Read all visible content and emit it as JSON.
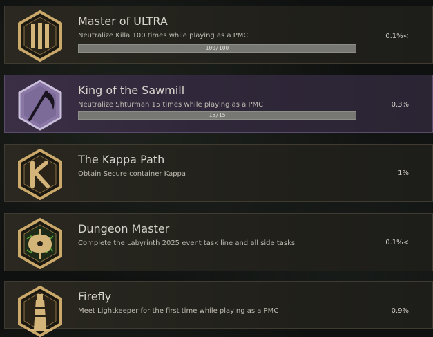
{
  "achievements": [
    {
      "title": "Master of ULTRA",
      "description": "Neutralize Killa 100 times while playing as a PMC",
      "progress_text": "100/100",
      "progress_fraction": 1.0,
      "rarity": "0.1%<",
      "icon": "triple-bars-icon",
      "theme": "gold"
    },
    {
      "title": "King of the Sawmill",
      "description": "Neutralize Shturman 15 times while playing as a PMC",
      "progress_text": "15/15",
      "progress_fraction": 1.0,
      "rarity": "0.3%",
      "icon": "scythe-icon",
      "theme": "purple"
    },
    {
      "title": "The Kappa Path",
      "description": "Obtain Secure container Kappa",
      "rarity": "1%",
      "icon": "kappa-icon",
      "theme": "gold"
    },
    {
      "title": "Dungeon Master",
      "description": "Complete the Labyrinth 2025 event task line and all side tasks",
      "rarity": "0.1%<",
      "icon": "battle-axe-icon",
      "theme": "gold"
    },
    {
      "title": "Firefly",
      "description": "Meet Lightkeeper for the first time while playing as a PMC",
      "rarity": "0.9%",
      "icon": "lighthouse-icon",
      "theme": "gold"
    }
  ],
  "colors": {
    "gold": "#c9a86a",
    "purple_badge": "#8a77a6"
  }
}
